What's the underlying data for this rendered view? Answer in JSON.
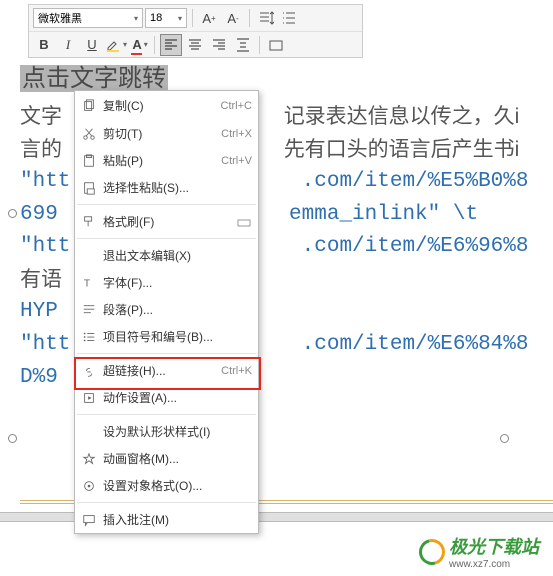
{
  "toolbar": {
    "font_name": "微软雅黑",
    "font_size": "18",
    "bold": "B",
    "italic": "I",
    "underline": "U"
  },
  "content": {
    "highlight_text": "点击文字跳转",
    "line1": "文字",
    "line1b": "记录表达信息以传之，久i",
    "line2": "言的",
    "line2b": "先有口头的语言后产生书i",
    "line3a": "\"htt",
    "line3b": ".com/item/%E5%B0%8",
    "line4a": "699",
    "line4b": "emma_inlink\" \\t",
    "line5a": "\"htt",
    "line5b": ".com/item/%E6%96%8",
    "line6a": "有语",
    "line7a": "HYP",
    "line8a": "\"htt",
    "line8b": ".com/item/%E6%84%8",
    "line9a": "D%9"
  },
  "menu": {
    "copy": "复制(C)",
    "copy_sc": "Ctrl+C",
    "cut": "剪切(T)",
    "cut_sc": "Ctrl+X",
    "paste": "粘贴(P)",
    "paste_sc": "Ctrl+V",
    "paste_special": "选择性粘贴(S)...",
    "format_painter": "格式刷(F)",
    "exit_text": "退出文本编辑(X)",
    "font": "字体(F)...",
    "paragraph": "段落(P)...",
    "bullets": "项目符号和编号(B)...",
    "hyperlink": "超链接(H)...",
    "hyperlink_sc": "Ctrl+K",
    "action_settings": "动作设置(A)...",
    "default_shape": "设为默认形状样式(I)",
    "anim_pane": "动画窗格(M)...",
    "format_object": "设置对象格式(O)...",
    "insert_comment": "插入批注(M)"
  },
  "footer": {
    "brand": "极光下载站",
    "url": "www.xz7.com"
  }
}
